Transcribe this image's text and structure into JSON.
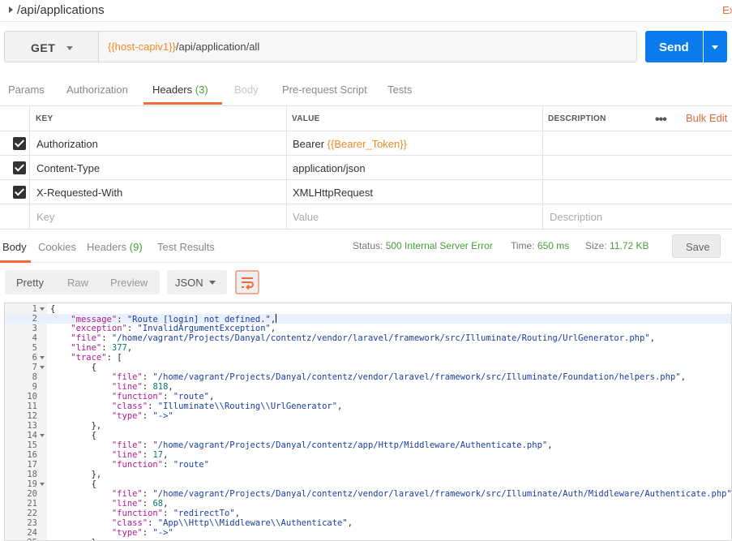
{
  "window": {
    "title": "/api/applications",
    "right_link": "Ex"
  },
  "request": {
    "method": "GET",
    "url_variable": "{{host-capiv1}}",
    "url_path": "/api/application/all",
    "send_label": "Send"
  },
  "request_tabs": [
    {
      "label": "Params"
    },
    {
      "label": "Authorization"
    },
    {
      "label": "Headers",
      "count": "(3)",
      "active": true
    },
    {
      "label": "Body",
      "disabled": true
    },
    {
      "label": "Pre-request Script"
    },
    {
      "label": "Tests"
    }
  ],
  "headers_table": {
    "columns": [
      "KEY",
      "VALUE",
      "DESCRIPTION"
    ],
    "bulk_edit": "Bulk Edit",
    "rows": [
      {
        "checked": true,
        "key": "Authorization",
        "value_prefix": "Bearer ",
        "value_var": "{{Bearer_Token}}",
        "description": ""
      },
      {
        "checked": true,
        "key": "Content-Type",
        "value_prefix": "application/json",
        "value_var": "",
        "description": ""
      },
      {
        "checked": true,
        "key": "X-Requested-With",
        "value_prefix": "XMLHttpRequest",
        "value_var": "",
        "description": ""
      }
    ],
    "placeholders": {
      "key": "Key",
      "value": "Value",
      "description": "Description"
    }
  },
  "response_tabs": [
    {
      "label": "Body",
      "active": true
    },
    {
      "label": "Cookies"
    },
    {
      "label": "Headers",
      "count": "(9)"
    },
    {
      "label": "Test Results"
    }
  ],
  "response_meta": {
    "status_label": "Status:",
    "status_value": "500 Internal Server Error",
    "time_label": "Time:",
    "time_value": "650 ms",
    "size_label": "Size:",
    "size_value": "11.72 KB",
    "save_label": "Save"
  },
  "view_modes": [
    "Pretty",
    "Raw",
    "Preview"
  ],
  "active_view": "Pretty",
  "format": "JSON",
  "code_lines": [
    {
      "n": "1",
      "fold": true,
      "text": "{"
    },
    {
      "n": "2",
      "text": "    \"message\": \"Route [login] not defined.\",",
      "current": true
    },
    {
      "n": "3",
      "text": "    \"exception\": \"InvalidArgumentException\","
    },
    {
      "n": "4",
      "text": "    \"file\": \"/home/vagrant/Projects/Danyal/contentz/vendor/laravel/framework/src/Illuminate/Routing/UrlGenerator.php\","
    },
    {
      "n": "5",
      "text": "    \"line\": 377,"
    },
    {
      "n": "6",
      "fold": true,
      "text": "    \"trace\": ["
    },
    {
      "n": "7",
      "fold": true,
      "text": "        {"
    },
    {
      "n": "8",
      "text": "            \"file\": \"/home/vagrant/Projects/Danyal/contentz/vendor/laravel/framework/src/Illuminate/Foundation/helpers.php\","
    },
    {
      "n": "9",
      "text": "            \"line\": 818,"
    },
    {
      "n": "10",
      "text": "            \"function\": \"route\","
    },
    {
      "n": "11",
      "text": "            \"class\": \"Illuminate\\\\Routing\\\\UrlGenerator\","
    },
    {
      "n": "12",
      "text": "            \"type\": \"->\""
    },
    {
      "n": "13",
      "text": "        },"
    },
    {
      "n": "14",
      "fold": true,
      "text": "        {"
    },
    {
      "n": "15",
      "text": "            \"file\": \"/home/vagrant/Projects/Danyal/contentz/app/Http/Middleware/Authenticate.php\","
    },
    {
      "n": "16",
      "text": "            \"line\": 17,"
    },
    {
      "n": "17",
      "text": "            \"function\": \"route\""
    },
    {
      "n": "18",
      "text": "        },"
    },
    {
      "n": "19",
      "fold": true,
      "text": "        {"
    },
    {
      "n": "20",
      "text": "            \"file\": \"/home/vagrant/Projects/Danyal/contentz/vendor/laravel/framework/src/Illuminate/Auth/Middleware/Authenticate.php\","
    },
    {
      "n": "21",
      "text": "            \"line\": 68,"
    },
    {
      "n": "22",
      "text": "            \"function\": \"redirectTo\","
    },
    {
      "n": "23",
      "text": "            \"class\": \"App\\\\Http\\\\Middleware\\\\Authenticate\","
    },
    {
      "n": "24",
      "text": "            \"type\": \"->\""
    },
    {
      "n": "25",
      "text": "        },"
    }
  ],
  "colors": {
    "accent": "#f26b3a",
    "send": "#097bed",
    "status_ok": "#4a9c3b",
    "variable": "#f08a24",
    "json_key": "#b11a8e",
    "json_string": "#1a3e9e",
    "json_number": "#0b7a6a"
  },
  "icons": {
    "collapse": "caret-right-icon",
    "method_dropdown": "chevron-down-icon",
    "send_dropdown": "chevron-down-icon",
    "more": "more-dots-icon",
    "checkbox": "checkbox-checked-icon",
    "wrap": "wrap-lines-icon"
  }
}
